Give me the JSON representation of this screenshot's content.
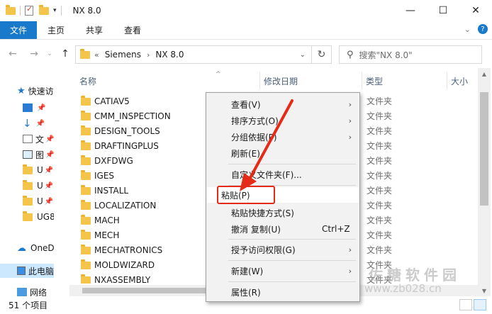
{
  "window": {
    "title": "NX 8.0",
    "controls": [
      "—",
      "☐",
      "✕"
    ]
  },
  "ribbon": {
    "tabs": [
      "文件",
      "主页",
      "共享",
      "查看"
    ]
  },
  "address": {
    "prefix": "«",
    "crumbs": [
      "Siemens",
      "NX 8.0"
    ]
  },
  "search": {
    "placeholder": "搜索\"NX 8.0\""
  },
  "nav_pane": {
    "quick_access": "快速访",
    "items": [
      "",
      "",
      "文",
      "图",
      "U",
      "U",
      "U",
      "UG8"
    ],
    "onedrive": "OneD",
    "this_pc": "此电脑",
    "network": "网络"
  },
  "columns": {
    "name": "名称",
    "date": "修改日期",
    "type": "类型",
    "size": "大小"
  },
  "files": [
    {
      "name": "CATIAV5",
      "type": "文件夹"
    },
    {
      "name": "CMM_INSPECTION",
      "type": "文件夹"
    },
    {
      "name": "DESIGN_TOOLS",
      "type": "文件夹"
    },
    {
      "name": "DRAFTINGPLUS",
      "type": "文件夹"
    },
    {
      "name": "DXFDWG",
      "type": "文件夹"
    },
    {
      "name": "IGES",
      "type": "文件夹"
    },
    {
      "name": "INSTALL",
      "type": "文件夹"
    },
    {
      "name": "LOCALIZATION",
      "type": "文件夹"
    },
    {
      "name": "MACH",
      "type": "文件夹"
    },
    {
      "name": "MECH",
      "type": "文件夹"
    },
    {
      "name": "MECHATRONICS",
      "type": "文件夹"
    },
    {
      "name": "MOLDWIZARD",
      "type": "文件夹"
    },
    {
      "name": "NXASSEMBLY",
      "type": "文件夹"
    }
  ],
  "status": {
    "count": "51 个项目"
  },
  "context_menu": {
    "view": "查看(V)",
    "sort": "排序方式(O)",
    "group": "分组依据(P)",
    "refresh": "刷新(E)",
    "customize": "自定义文件夹(F)...",
    "paste": "粘贴(P)",
    "paste_shortcut": "粘贴快捷方式(S)",
    "undo": "撤消 复制(U)",
    "undo_shortcut": "Ctrl+Z",
    "give_access": "授予访问权限(G)",
    "new": "新建(W)",
    "properties": "属性(R)"
  },
  "watermark": {
    "line1": "佐糖软件园",
    "line2": "www.zb028.cn"
  },
  "colors": {
    "file_tab": "#1979ca",
    "annotation": "#e52a18",
    "folder": "#f4c54a"
  }
}
